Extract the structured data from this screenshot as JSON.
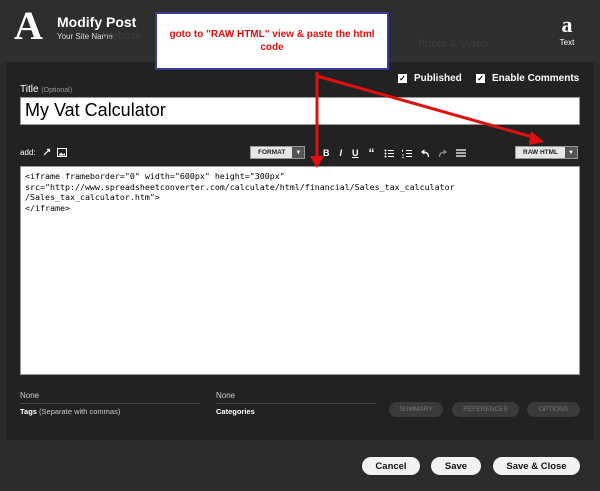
{
  "header": {
    "title": "Modify Post",
    "subtitle": "Your Site Name",
    "text_icon_label": "Text",
    "faint_left": "Website",
    "faint_right": "Photo & Video"
  },
  "callout": {
    "text": "goto to \"RAW HTML\" view & paste the html code"
  },
  "options": {
    "published": "Published",
    "enable_comments": "Enable Comments"
  },
  "title_field": {
    "label": "Title",
    "optional": "(Optional)",
    "value": "My Vat Calculator"
  },
  "toolbar": {
    "add_label": "add:",
    "format": "FORMAT",
    "raw_html": "RAW HTML"
  },
  "editor": {
    "content": "<iframe frameborder=\"0\" width=\"600px\" height=\"300px\"\nsrc=\"http://www.spreadsheetconverter.com/calculate/html/financial/Sales_tax_calculator\n/Sales_tax_calculator.htm\">\n</iframe>"
  },
  "tags": {
    "value": "None",
    "label": "Tags",
    "hint": "(Separate with commas)"
  },
  "categories": {
    "value": "None",
    "label": "Categories"
  },
  "tabs": {
    "summary": "SUMMARY",
    "references": "REFERENCES",
    "options": "OPTIONS"
  },
  "actions": {
    "cancel": "Cancel",
    "save": "Save",
    "save_close": "Save & Close"
  },
  "colors": {
    "annotation": "#e01010",
    "background": "#2b2b2b"
  }
}
